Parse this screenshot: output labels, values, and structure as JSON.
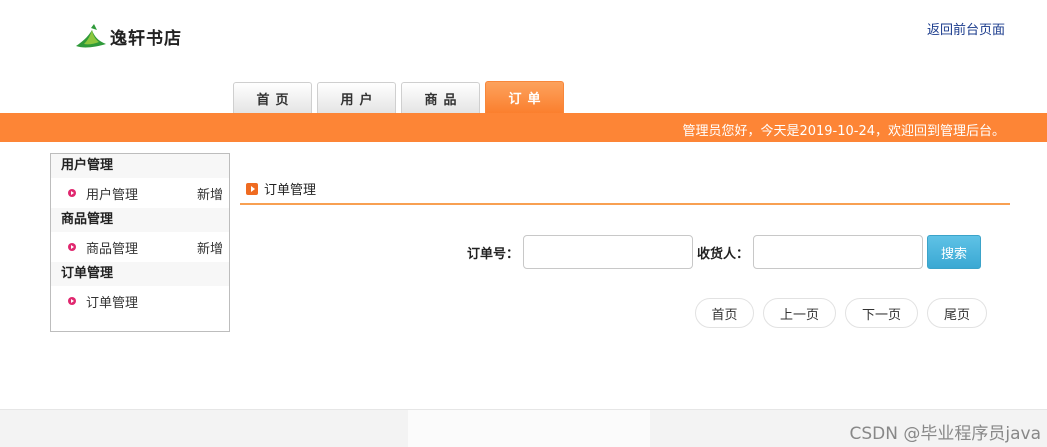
{
  "header": {
    "logo_text": "逸轩书店",
    "back_link": "返回前台页面"
  },
  "tabs": [
    {
      "label": "首页",
      "active": false
    },
    {
      "label": "用户",
      "active": false
    },
    {
      "label": "商品",
      "active": false
    },
    {
      "label": "订单",
      "active": true
    }
  ],
  "topbar": {
    "welcome": "管理员您好，今天是2019-10-24，欢迎回到管理后台。"
  },
  "sidebar": {
    "groups": [
      {
        "title": "用户管理",
        "item": "用户管理",
        "add": "新增"
      },
      {
        "title": "商品管理",
        "item": "商品管理",
        "add": "新增"
      },
      {
        "title": "订单管理",
        "item": "订单管理",
        "add": ""
      }
    ]
  },
  "main": {
    "title": "订单管理",
    "search": {
      "order_label": "订单号：",
      "order_value": "",
      "receiver_label": "收货人：",
      "receiver_value": "",
      "button": "搜索"
    },
    "pager": {
      "first": "首页",
      "prev": "上一页",
      "next": "下一页",
      "last": "尾页"
    }
  },
  "footer": {
    "watermark": "CSDN @毕业程序员java"
  },
  "colors": {
    "accent": "#fd8536",
    "search_button": "#3aa8d3",
    "bullet": "#e0286f"
  }
}
